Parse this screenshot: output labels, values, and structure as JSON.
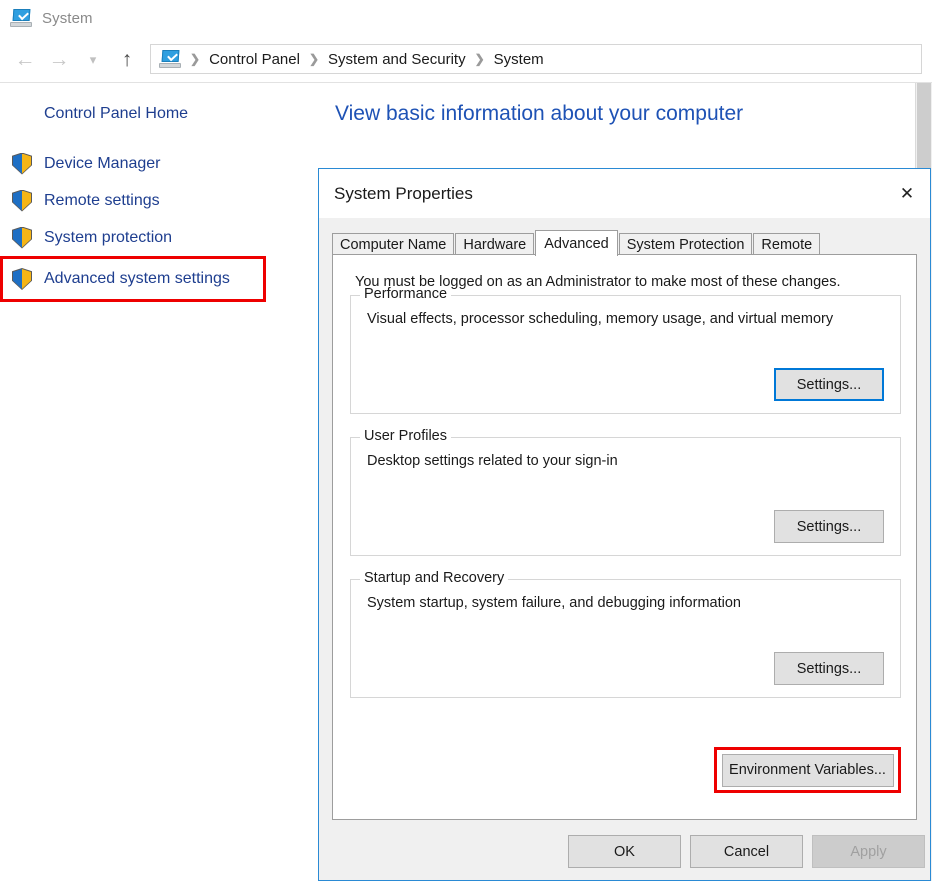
{
  "window": {
    "title": "System",
    "icon": "computer-icon"
  },
  "addressbar": {
    "back_icon": "arrow-left-icon",
    "forward_icon": "arrow-right-icon",
    "history_icon": "chevron-down-icon",
    "up_icon": "arrow-up-icon",
    "breadcrumb": {
      "icon": "computer-icon",
      "separator": "❯",
      "items": [
        "Control Panel",
        "System and Security",
        "System"
      ]
    }
  },
  "sidebar": {
    "home_label": "Control Panel Home",
    "items": [
      {
        "label": "Device Manager",
        "icon": "shield-icon",
        "highlighted": false
      },
      {
        "label": "Remote settings",
        "icon": "shield-icon",
        "highlighted": false
      },
      {
        "label": "System protection",
        "icon": "shield-icon",
        "highlighted": false
      },
      {
        "label": "Advanced system settings",
        "icon": "shield-icon",
        "highlighted": true
      }
    ]
  },
  "main": {
    "heading": "View basic information about your computer"
  },
  "dialog": {
    "title": "System Properties",
    "close_icon": "close-icon",
    "tabs": [
      {
        "label": "Computer Name",
        "active": false
      },
      {
        "label": "Hardware",
        "active": false
      },
      {
        "label": "Advanced",
        "active": true
      },
      {
        "label": "System Protection",
        "active": false
      },
      {
        "label": "Remote",
        "active": false
      }
    ],
    "admin_note": "You must be logged on as an Administrator to make most of these changes.",
    "groups": [
      {
        "legend": "Performance",
        "description": "Visual effects, processor scheduling, memory usage, and virtual memory",
        "button_label": "Settings..."
      },
      {
        "legend": "User Profiles",
        "description": "Desktop settings related to your sign-in",
        "button_label": "Settings..."
      },
      {
        "legend": "Startup and Recovery",
        "description": "System startup, system failure, and debugging information",
        "button_label": "Settings..."
      }
    ],
    "environment_variables_label": "Environment Variables...",
    "footer": {
      "ok_label": "OK",
      "cancel_label": "Cancel",
      "apply_label": "Apply"
    }
  },
  "colors": {
    "accent_blue": "#0078d7",
    "link_blue": "#1e3e8f",
    "heading_blue": "#1e52b5",
    "highlight_red": "#ee0000",
    "dialog_border": "#2a8ad4"
  }
}
